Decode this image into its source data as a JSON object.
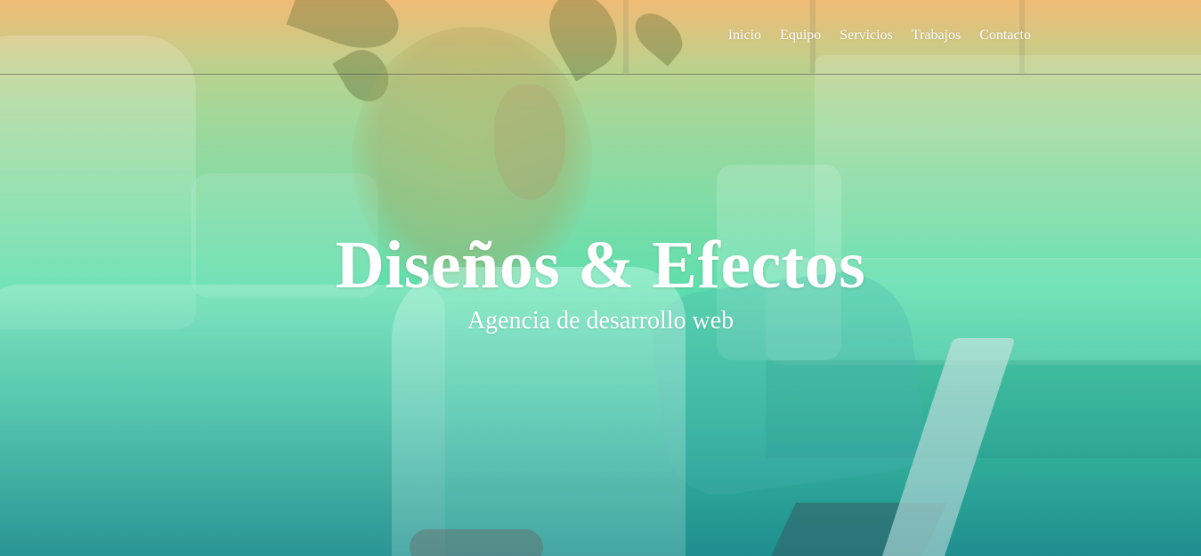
{
  "nav": {
    "items": [
      {
        "label": "Inicio"
      },
      {
        "label": "Equipo"
      },
      {
        "label": "Servicios"
      },
      {
        "label": "Trabajos"
      },
      {
        "label": "Contacto"
      }
    ]
  },
  "hero": {
    "title": "Diseños & Efectos",
    "subtitle": "Agencia de desarrollo web"
  },
  "colors": {
    "gradient_top": "#f0c07a",
    "gradient_mid": "#62dfae",
    "gradient_bottom": "#1f8f90",
    "text": "#ffffff"
  }
}
